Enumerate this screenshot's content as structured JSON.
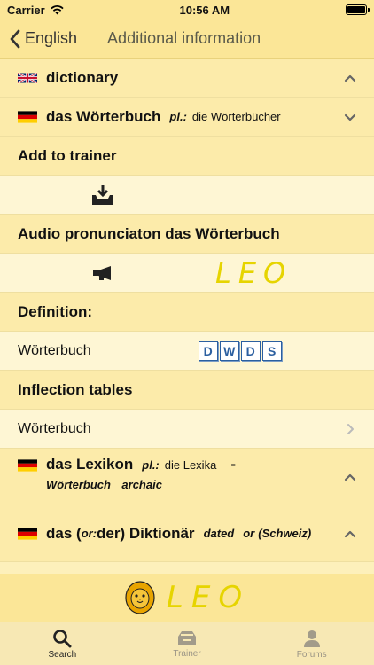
{
  "status": {
    "carrier": "Carrier",
    "time": "10:56 AM"
  },
  "nav": {
    "back_label": "English",
    "title": "Additional information"
  },
  "entry_en": {
    "word": "dictionary"
  },
  "entry_de": {
    "word": "das Wörterbuch",
    "gram": "pl.:",
    "plural": "die Wörterbücher"
  },
  "sections": {
    "add_to_trainer": "Add to trainer",
    "audio": "Audio pronunciaton das Wörterbuch",
    "definition": "Definition:",
    "definition_word": "Wörterbuch",
    "inflection": "Inflection tables",
    "inflection_word": "Wörterbuch"
  },
  "synonym1": {
    "word": "das Lexikon",
    "gram": "pl.:",
    "plural": "die Lexika",
    "dash": "-",
    "line2_word": "Wörterbuch",
    "line2_note": "archaic"
  },
  "synonym2": {
    "word_prefix": "das (",
    "or_label": "or:",
    "word_suffix": " der) Diktionär",
    "note1": "dated",
    "note2": "or",
    "note3": "(Schweiz)"
  },
  "logo_text": "LEO",
  "dwds_letters": [
    "D",
    "W",
    "D",
    "S"
  ],
  "tabs": [
    {
      "label": "Search",
      "icon": "magnifier-icon"
    },
    {
      "label": "Trainer",
      "icon": "tray-icon"
    },
    {
      "label": "Forums",
      "icon": "person-icon"
    }
  ]
}
